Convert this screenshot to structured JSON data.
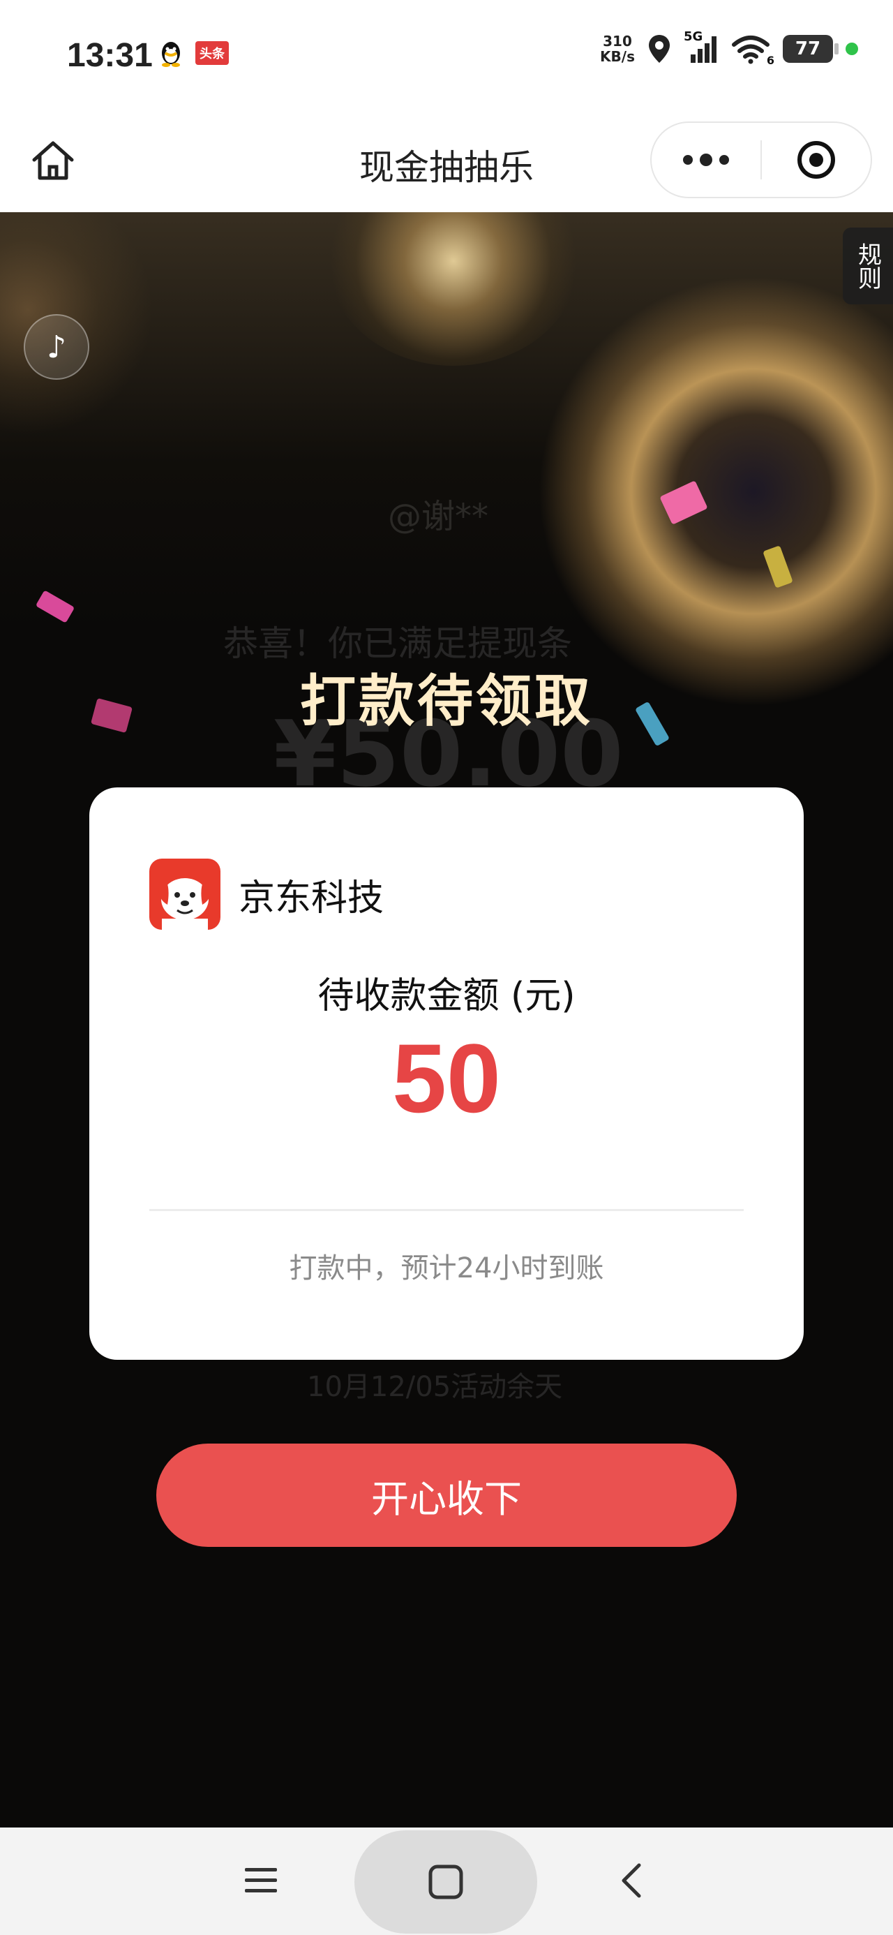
{
  "status_bar": {
    "time": "13:31",
    "app_badge": "头条",
    "net_speed_value": "310",
    "net_speed_unit": "KB/s",
    "network_type": "5G",
    "wifi_level": "6",
    "battery": "77"
  },
  "mini_program": {
    "title": "现金抽抽乐"
  },
  "stage": {
    "rules_label": "规则",
    "headline": "打款待领取",
    "faint_user": "@谢**",
    "faint_congrats": "恭喜！你已满足提现条",
    "faint_amount": "¥50.00",
    "faint_footer": "10月12/05活动余天"
  },
  "card": {
    "brand_name": "京东科技",
    "amount_label": "待收款金额 (元)",
    "amount": "50",
    "note": "打款中，预计24小时到账"
  },
  "accept_button": "开心收下",
  "colors": {
    "accent": "#ea5150",
    "amount": "#e64545",
    "headline": "#ffedc9",
    "stage_bg": "#0a0908"
  }
}
